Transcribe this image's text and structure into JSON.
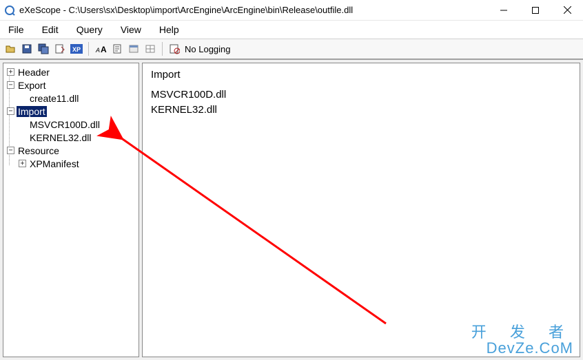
{
  "window": {
    "title": "eXeScope - C:\\Users\\sx\\Desktop\\import\\ArcEngine\\ArcEngine\\bin\\Release\\outfile.dll"
  },
  "menu": {
    "file": "File",
    "edit": "Edit",
    "query": "Query",
    "view": "View",
    "help": "Help"
  },
  "toolbar": {
    "no_logging": "No Logging"
  },
  "tree": {
    "header": "Header",
    "export": "Export",
    "export_items": {
      "0": "create11.dll"
    },
    "import": "Import",
    "import_items": {
      "0": "MSVCR100D.dll",
      "1": "KERNEL32.dll"
    },
    "resource": "Resource",
    "resource_items": {
      "0": "XPManifest"
    }
  },
  "content": {
    "heading": "Import",
    "lines": {
      "0": "MSVCR100D.dll",
      "1": "KERNEL32.dll"
    }
  },
  "watermark": {
    "line1": "开 发 者",
    "line2": "DevZe.CoM"
  }
}
